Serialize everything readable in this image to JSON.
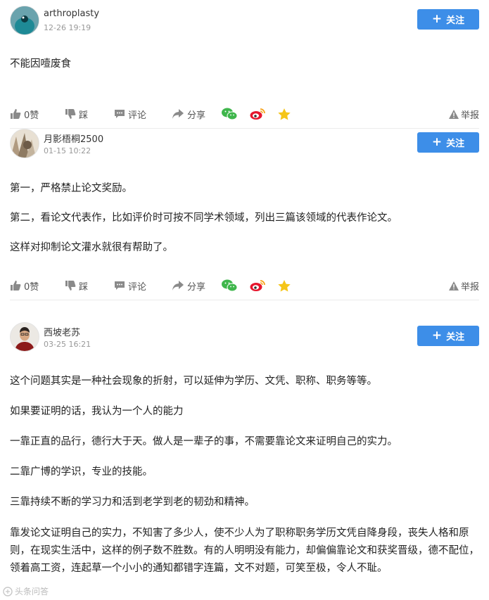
{
  "posts": [
    {
      "username": "arthroplasty",
      "time": "12-26 19:19",
      "follow_label": "关注",
      "paragraphs": [
        "不能因噎废食"
      ],
      "actions": {
        "like": "0赞",
        "dislike": "踩",
        "comment": "评论",
        "share": "分享",
        "report": "举报"
      }
    },
    {
      "username": "月影梧桐2500",
      "time": "01-15 10:22",
      "follow_label": "关注",
      "paragraphs": [
        "第一，严格禁止论文奖励。",
        "第二，看论文代表作，比如评价时可按不同学术领域，列出三篇该领域的代表作论文。",
        "这样对抑制论文灌水就很有帮助了。"
      ],
      "actions": {
        "like": "0赞",
        "dislike": "踩",
        "comment": "评论",
        "share": "分享",
        "report": "举报"
      }
    },
    {
      "username": "西坡老苏",
      "time": "03-25 16:21",
      "follow_label": "关注",
      "paragraphs": [
        "这个问题其实是一种社会现象的折射，可以延伸为学历、文凭、职称、职务等等。",
        "如果要证明的话，我认为一个人的能力",
        "一靠正直的品行，德行大于天。做人是一辈子的事，不需要靠论文来证明自己的实力。",
        "二靠广博的学识，专业的技能。",
        "三靠持续不断的学习力和活到老学到老的韧劲和精神。",
        "靠发论文证明自己的实力，不知害了多少人，使不少人为了职称职务学历文凭自降身段，丧失人格和原则，在现实生活中，这样的例子数不胜数。有的人明明没有能力，却偏偏靠论文和获奖晋级，德不配位，领着高工资，连起草一个小小的通知都错字连篇，文不对题，可笑至极，令人不耻。"
      ]
    }
  ],
  "watermark": "头条问答",
  "colors": {
    "follow_bg": "#3d8ee8",
    "wechat": "#3fb64c",
    "weibo": "#e6162d",
    "star": "#f5c518"
  },
  "icons": [
    "thumb-up-icon",
    "thumb-down-icon",
    "comment-icon",
    "share-icon",
    "wechat-icon",
    "weibo-icon",
    "star-icon",
    "warning-icon",
    "plus-icon"
  ]
}
